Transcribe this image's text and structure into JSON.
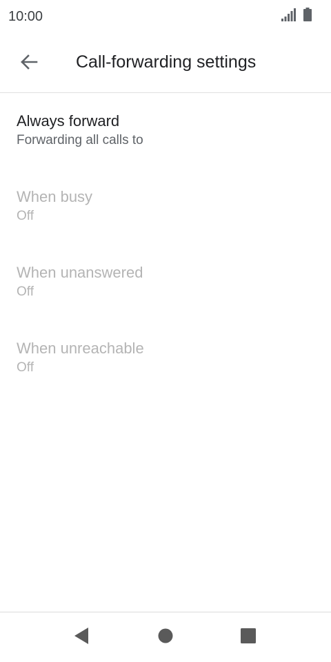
{
  "status_bar": {
    "time": "10:00",
    "icons": [
      "signal-icon",
      "battery-icon"
    ]
  },
  "app_bar": {
    "back_icon": "arrow-back-icon",
    "title": "Call-forwarding settings"
  },
  "settings": [
    {
      "title": "Always forward",
      "summary": "Forwarding all calls to",
      "enabled": true
    },
    {
      "title": "When busy",
      "summary": "Off",
      "enabled": false
    },
    {
      "title": "When unanswered",
      "summary": "Off",
      "enabled": false
    },
    {
      "title": "When unreachable",
      "summary": "Off",
      "enabled": false
    }
  ],
  "nav_bar": {
    "icons": [
      "back-triangle-icon",
      "home-circle-icon",
      "recents-square-icon"
    ]
  },
  "colors": {
    "primary_text": "#202124",
    "secondary_text": "#5f6368",
    "disabled_text": "#b4b4b4",
    "icon": "#5f6368",
    "nav_icon": "#5a5a5a",
    "divider": "#e0e0e0"
  }
}
